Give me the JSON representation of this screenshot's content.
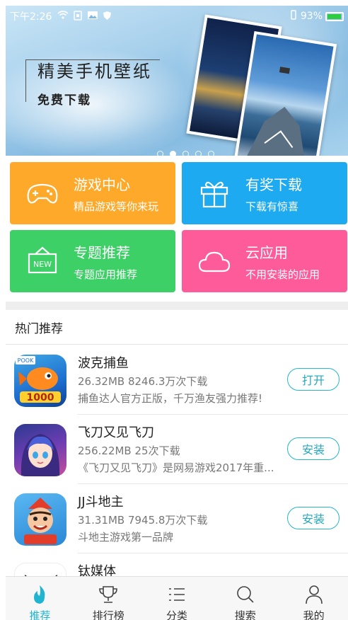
{
  "status_bar": {
    "time": "下午2:26",
    "battery": "93%"
  },
  "banner": {
    "title": "精美手机壁纸",
    "subtitle": "免费下载",
    "slide_count": 5,
    "active_slide": 2
  },
  "categories": [
    {
      "title": "游戏中心",
      "subtitle": "精品游戏等你来玩",
      "icon": "gamepad-icon",
      "color": "#ffa92b"
    },
    {
      "title": "有奖下载",
      "subtitle": "下载有惊喜",
      "icon": "gift-icon",
      "color": "#1daaf0"
    },
    {
      "title": "专题推荐",
      "subtitle": "专题应用推荐",
      "icon": "new-sign-icon",
      "color": "#3cd067"
    },
    {
      "title": "云应用",
      "subtitle": "不用安装的应用",
      "icon": "cloud-icon",
      "color": "#fd5b9a"
    }
  ],
  "hot_section": {
    "title": "热门推荐"
  },
  "apps": [
    {
      "name": "波克捕鱼",
      "meta": "26.32MB 8246.3万次下载",
      "desc": "捕鱼达人官方正版，千万渔友强力推荐!",
      "button": "打开"
    },
    {
      "name": "飞刀又见飞刀",
      "meta": "256.22MB 25次下载",
      "desc": "《飞刀又见飞刀》是网易游戏2017年重...",
      "button": "安装"
    },
    {
      "name": "JJ斗地主",
      "meta": "31.31MB 7945.8万次下载",
      "desc": "斗地主游戏第一品牌",
      "button": "安装"
    },
    {
      "name": "钛媒体",
      "meta": "",
      "desc": "",
      "button": ""
    }
  ],
  "tabs": [
    {
      "label": "推荐",
      "icon": "flame-icon",
      "active": true
    },
    {
      "label": "排行榜",
      "icon": "trophy-icon",
      "active": false
    },
    {
      "label": "分类",
      "icon": "list-icon",
      "active": false
    },
    {
      "label": "搜索",
      "icon": "search-icon",
      "active": false
    },
    {
      "label": "我的",
      "icon": "person-icon",
      "active": false
    }
  ],
  "colors": {
    "accent": "#1fb5d0",
    "button_border": "#26b5c9"
  }
}
